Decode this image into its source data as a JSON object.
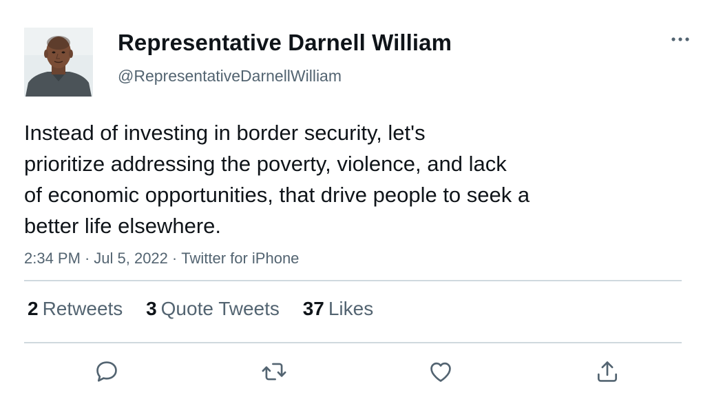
{
  "author": {
    "display_name": "Representative Darnell William",
    "handle": "@RepresentativeDarnellWilliam"
  },
  "tweet": {
    "lines": [
      "Instead of investing in border security, let's",
      "prioritize addressing the poverty, violence, and lack",
      "of economic opportunities, that drive people to seek a",
      "better life elsewhere."
    ],
    "time": "2:34 PM",
    "date": "Jul 5, 2022",
    "source": "Twitter for iPhone",
    "separator": "·"
  },
  "stats": {
    "retweets": {
      "count": "2",
      "label": "Retweets"
    },
    "quotes": {
      "count": "3",
      "label": "Quote Tweets"
    },
    "likes": {
      "count": "37",
      "label": "Likes"
    }
  },
  "icons": {
    "more": "more-icon",
    "reply": "reply-icon",
    "retweet": "retweet-icon",
    "like": "heart-icon",
    "share": "share-icon"
  },
  "colors": {
    "text": "#0f1419",
    "secondary": "#536471",
    "divider": "#cfd9de"
  }
}
